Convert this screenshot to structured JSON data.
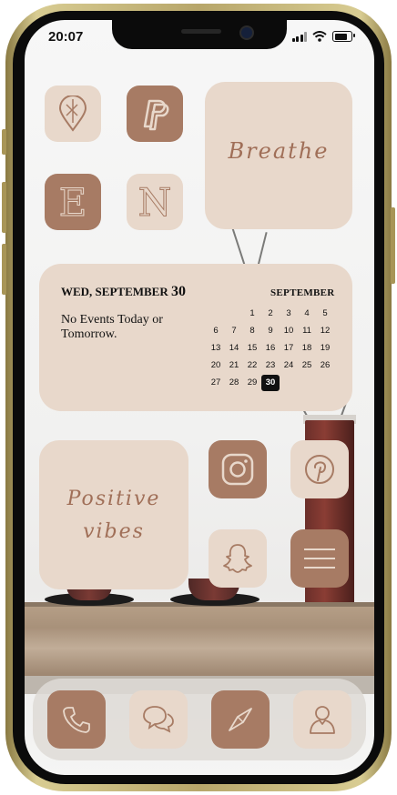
{
  "status_bar": {
    "time": "20:07",
    "battery_level": 0.8
  },
  "theme": {
    "light_tile": "#e8d8cb",
    "dark_tile": "#a77b64",
    "script_color": "#a06f58"
  },
  "apps": {
    "maps": {
      "icon": "map-pin-icon"
    },
    "paypal": {
      "icon": "paypal-icon"
    },
    "e_app": {
      "letter": "E"
    },
    "n_app": {
      "letter": "N"
    },
    "instagram": {
      "icon": "instagram-icon"
    },
    "pinterest": {
      "icon": "pinterest-icon"
    },
    "snapchat": {
      "icon": "snapchat-icon"
    },
    "menu": {
      "icon": "menu-icon"
    }
  },
  "widgets": {
    "breathe": {
      "text": "Breathe"
    },
    "positive": {
      "line1": "Positive",
      "line2": "vibes"
    },
    "calendar": {
      "day_label": "WED, SEPTEMBER",
      "day_number": "30",
      "events": "No Events Today or Tomorrow.",
      "month": "SEPTEMBER",
      "days": [
        "",
        "",
        "1",
        "2",
        "3",
        "4",
        "5",
        "6",
        "7",
        "8",
        "9",
        "10",
        "11",
        "12",
        "13",
        "14",
        "15",
        "16",
        "17",
        "18",
        "19",
        "20",
        "21",
        "22",
        "23",
        "24",
        "25",
        "26",
        "27",
        "28",
        "29",
        "30"
      ],
      "today": "30"
    }
  },
  "dock": {
    "items": [
      {
        "icon": "phone-icon"
      },
      {
        "icon": "messages-icon"
      },
      {
        "icon": "compass-icon"
      },
      {
        "icon": "contacts-icon"
      }
    ]
  }
}
